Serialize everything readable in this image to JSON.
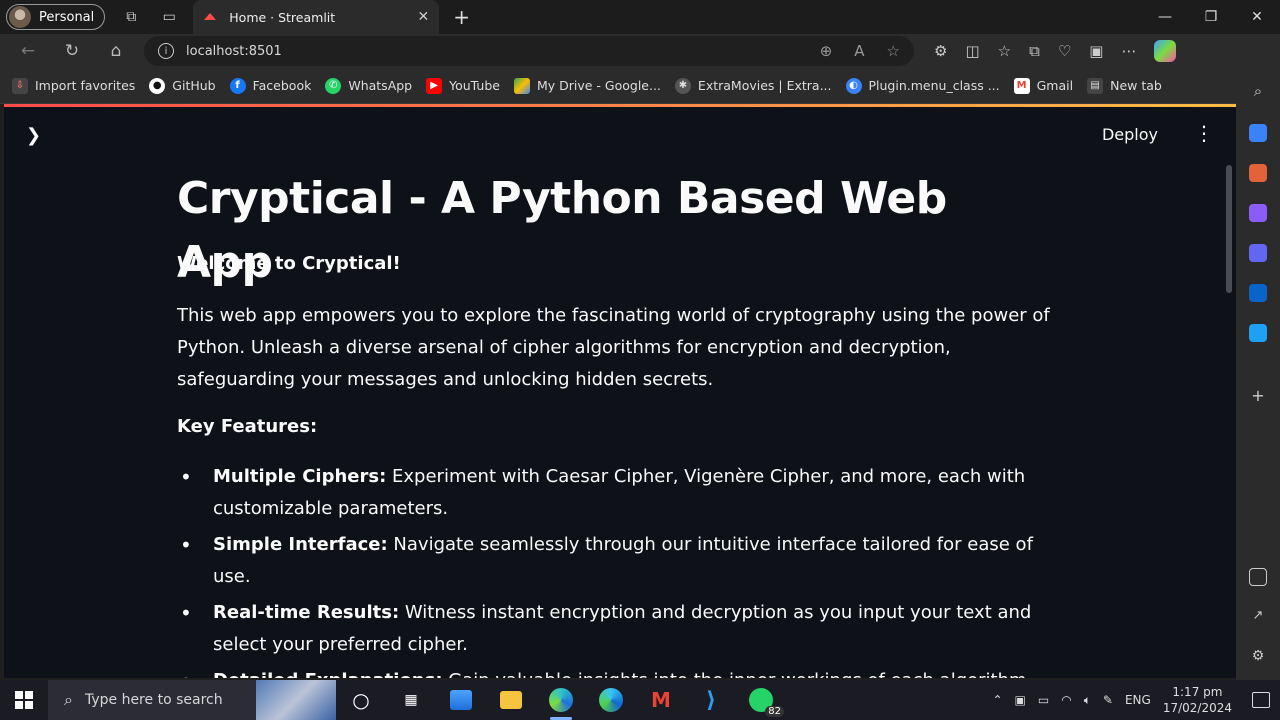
{
  "browser": {
    "profile_label": "Personal",
    "tab_title": "Home · Streamlit",
    "url": "localhost:8501"
  },
  "bookmarks": [
    {
      "label": "Import favorites",
      "color": "#ff4b4b"
    },
    {
      "label": "GitHub",
      "color": "#ffffff"
    },
    {
      "label": "Facebook",
      "color": "#1877f2"
    },
    {
      "label": "WhatsApp",
      "color": "#25d366"
    },
    {
      "label": "YouTube",
      "color": "#ff0000"
    },
    {
      "label": "My Drive - Google...",
      "color": "#fbbc04"
    },
    {
      "label": "ExtraMovies | Extra...",
      "color": "#bbbbbb"
    },
    {
      "label": "Plugin.menu_class ...",
      "color": "#3b82f6"
    },
    {
      "label": "Gmail",
      "color": "#ea4335"
    },
    {
      "label": "New tab",
      "color": "#cccccc"
    }
  ],
  "streamlit": {
    "deploy_label": "Deploy",
    "title": "Cryptical - A Python Based Web App",
    "welcome": "Welcome to Cryptical!",
    "intro": "This web app empowers you to explore the fascinating world of cryptography using the power of Python. Unleash a diverse arsenal of cipher algorithms for encryption and decryption, safeguarding your messages and unlocking hidden secrets.",
    "features_heading": "Key Features:",
    "features": [
      {
        "name": "Multiple Ciphers:",
        "text": "Experiment with Caesar Cipher, Vigenère Cipher, and more, each with customizable parameters."
      },
      {
        "name": "Simple Interface:",
        "text": "Navigate seamlessly through our intuitive interface tailored for ease of use."
      },
      {
        "name": "Real-time Results:",
        "text": "Witness instant encryption and decryption as you input your text and select your preferred cipher."
      },
      {
        "name": "Detailed Explanations:",
        "text": "Gain valuable insights into the inner workings of each algorithm through"
      }
    ]
  },
  "taskbar": {
    "search_placeholder": "Type here to search",
    "whatsapp_badge": "82",
    "language": "ENG",
    "time": "1:17 pm",
    "date": "17/02/2024"
  }
}
